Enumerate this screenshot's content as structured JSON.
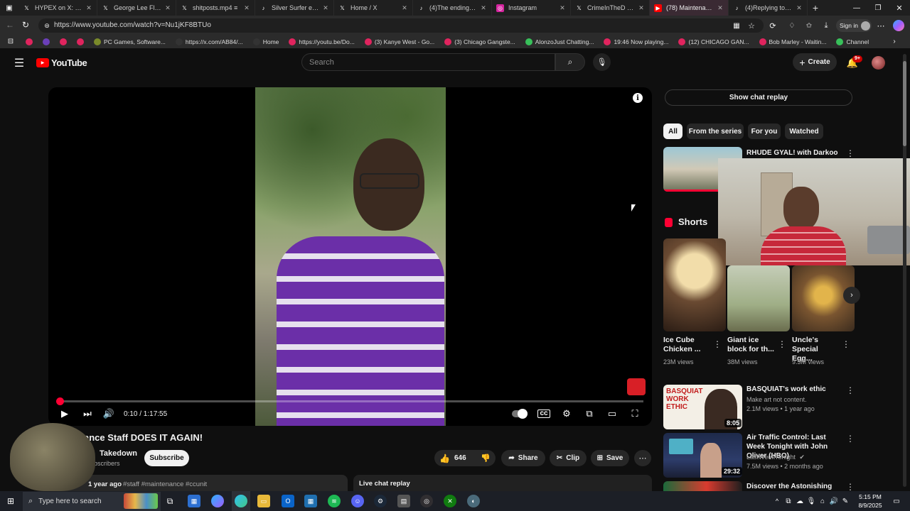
{
  "browser": {
    "tabs": [
      {
        "title": "HYPEX on X: \"A vid",
        "icon": "x-logo-icon",
        "active": false
      },
      {
        "title": "George Lee Floyd (I",
        "icon": "x-logo-icon",
        "active": false
      },
      {
        "title": "shitposts.mp4 ≡",
        "icon": "x-logo-icon",
        "active": false
      },
      {
        "title": "Silver Surfer en el u",
        "icon": "tiktok-icon",
        "active": false
      },
      {
        "title": "Home / X",
        "icon": "x-logo-icon",
        "active": false
      },
      {
        "title": "(4)The ending to th",
        "icon": "tiktok-icon",
        "active": false
      },
      {
        "title": "Instagram",
        "icon": "instagram-icon",
        "active": false
      },
      {
        "title": "CrimeInTheD ® on",
        "icon": "x-logo-icon",
        "active": false
      },
      {
        "title": "(78) Maintenance S",
        "icon": "youtube-icon",
        "active": true
      },
      {
        "title": "(4)Replying to @M",
        "icon": "tiktok-icon",
        "active": false
      }
    ],
    "new_tab": "+",
    "url": "https://www.youtube.com/watch?v=Nu1jKF8BTUo",
    "sign_in": "Sign in",
    "bookmarks": [
      {
        "label": "",
        "color": "#e0245e"
      },
      {
        "label": "",
        "color": "#6b3fb8"
      },
      {
        "label": "",
        "color": "#e0245e"
      },
      {
        "label": "",
        "color": "#e0245e"
      },
      {
        "label": "PC Games, Software...",
        "color": "#7a8a2a"
      },
      {
        "label": "https://x.com/AB84/...",
        "color": "#333333"
      },
      {
        "label": "Home",
        "color": "#333333"
      },
      {
        "label": "https://youtu.be/Do...",
        "color": "#e0245e"
      },
      {
        "label": "(3) Kanye West - Go...",
        "color": "#e0245e"
      },
      {
        "label": "(3) Chicago Gangste...",
        "color": "#e0245e"
      },
      {
        "label": "AlonzoJust Chatting...",
        "color": "#38c05a"
      },
      {
        "label": "19:46 Now playing...",
        "color": "#e0245e"
      },
      {
        "label": "(12) CHICAGO GAN...",
        "color": "#e0245e"
      },
      {
        "label": "Bob Marley - Waitin...",
        "color": "#e0245e"
      },
      {
        "label": "Channel",
        "color": "#38c05a"
      }
    ]
  },
  "youtube": {
    "logo": "YouTube",
    "search_placeholder": "Search",
    "create_label": "Create",
    "notif_badge": "9+",
    "player": {
      "time": "0:10 / 1:17:55",
      "progress_fraction": 0.0021
    },
    "video_title_visible": "ance Staff DOES IT AGAIN!",
    "channel_visible": "Takedown",
    "subscribers_visible": "bscribers",
    "subscribe_label": "Subscribe",
    "likes": "646",
    "share_label": "Share",
    "clip_label": "Clip",
    "save_label": "Save",
    "meta_visible": "1 year ago",
    "hashtags": "#staff #maintenance #ccunit",
    "chat_replay_label": "Live chat replay",
    "show_chat_replay": "Show chat replay",
    "chips": [
      "All",
      "From the series",
      "For you",
      "Watched"
    ],
    "rec_top_title": "RHUDE GYAL! with Darkoo",
    "shorts_title": "Shorts",
    "shorts": [
      {
        "title": "Ice Cube Chicken ...",
        "views": "23M views"
      },
      {
        "title": "Giant ice block for th...",
        "views": "38M views"
      },
      {
        "title": "Uncle's Special Egg...",
        "views": "9.3M views"
      }
    ],
    "recs": [
      {
        "title": "BASQUIAT's work ethic",
        "channel": "Make art not content.",
        "meta": "2.1M views • 1 year ago",
        "duration": "8:05",
        "thumb_text": "BASQUIAT WORK ETHIC"
      },
      {
        "title": "Air Traffic Control: Last Week Tonight with John Oliver (HBO)",
        "channel": "LastWeekTonight",
        "meta": "7.5M views • 2 months ago",
        "duration": "29:32",
        "thumb_text": ""
      },
      {
        "title": "Discover the Astonishing Truth",
        "channel": "",
        "meta": "",
        "duration": "",
        "thumb_text": ""
      }
    ]
  },
  "taskbar": {
    "search_placeholder": "Type here to search",
    "time": "5:15 PM",
    "date": "8/9/2025"
  }
}
